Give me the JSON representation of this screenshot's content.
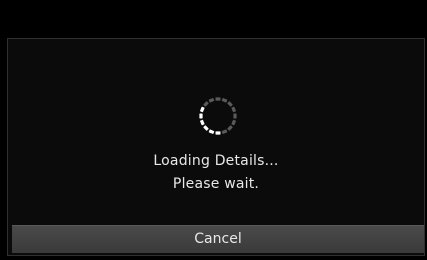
{
  "dialog": {
    "message_line_1": "Loading Details...",
    "message_line_2": "Please wait.",
    "cancel_label": "Cancel"
  },
  "colors": {
    "background": "#000000",
    "dialog_background": "#0b0b0b",
    "button_background": "#444444",
    "text": "#e8e8e8",
    "spinner_active": "#ffffff",
    "spinner_inactive": "#5a5a5a"
  },
  "icons": {
    "spinner": "loading-spinner-icon"
  }
}
